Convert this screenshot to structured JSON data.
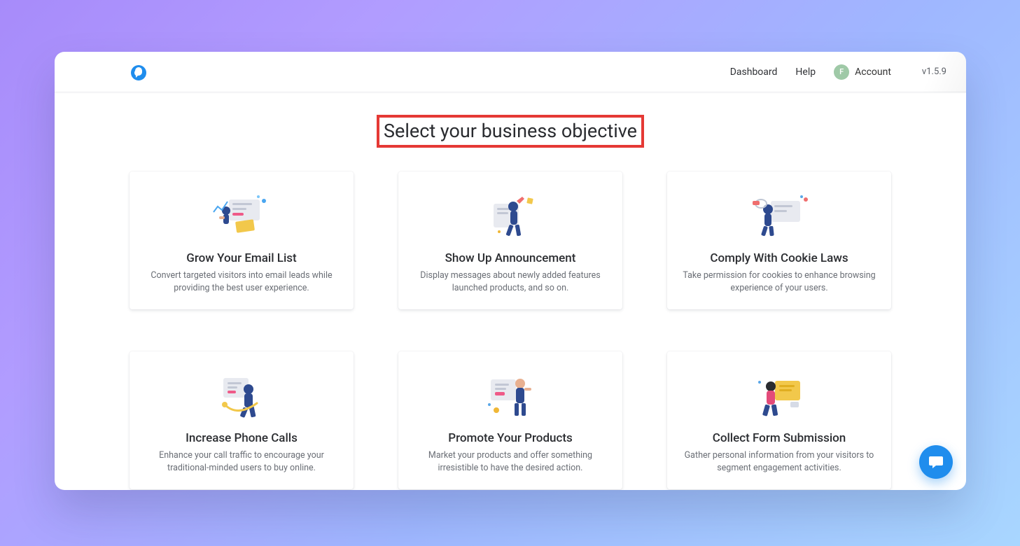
{
  "nav": {
    "dashboard": "Dashboard",
    "help": "Help",
    "account_label": "Account",
    "avatar_initial": "F",
    "version": "v1.5.9"
  },
  "page": {
    "title": "Select your business objective"
  },
  "cards": [
    {
      "title": "Grow Your Email List",
      "desc": "Convert targeted visitors into email leads while providing the best user experience."
    },
    {
      "title": "Show Up Announcement",
      "desc": "Display messages about newly added features launched products, and so on."
    },
    {
      "title": "Comply With Cookie Laws",
      "desc": "Take permission for cookies to enhance browsing experience of your users."
    },
    {
      "title": "Increase Phone Calls",
      "desc": "Enhance your call traffic to encourage your traditional-minded users to buy online."
    },
    {
      "title": "Promote Your Products",
      "desc": "Market your products and offer something irresistible to have the desired action."
    },
    {
      "title": "Collect Form Submission",
      "desc": "Gather personal information from your visitors to segment engagement activities."
    }
  ]
}
